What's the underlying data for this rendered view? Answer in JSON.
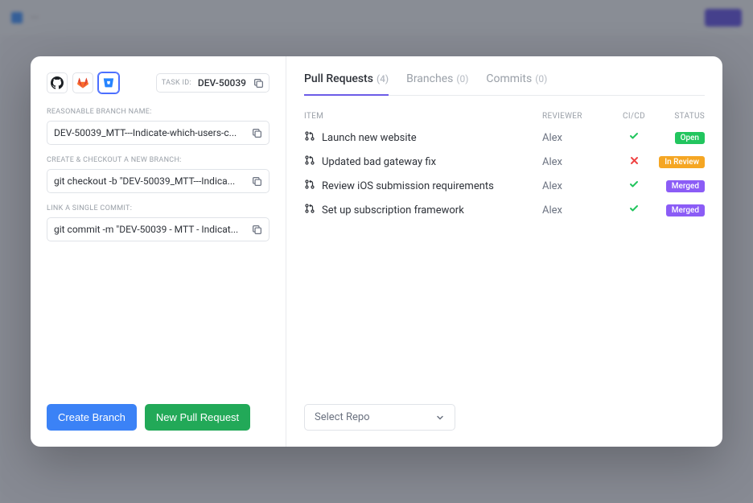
{
  "task_id": {
    "label": "TASK ID:",
    "value": "DEV-50039"
  },
  "fields": {
    "branch_name": {
      "label": "REASONABLE BRANCH NAME:",
      "value": "DEV-50039_MTT---Indicate-which-users-c..."
    },
    "checkout": {
      "label": "CREATE & CHECKOUT A NEW BRANCH:",
      "value": "git checkout -b \"DEV-50039_MTT---Indica..."
    },
    "commit": {
      "label": "LINK A SINGLE COMMIT:",
      "value": "git commit -m \"DEV-50039 - MTT - Indicat..."
    }
  },
  "buttons": {
    "create_branch": "Create Branch",
    "new_pr": "New Pull Request"
  },
  "tabs": [
    {
      "label": "Pull Requests",
      "count": "(4)",
      "active": true
    },
    {
      "label": "Branches",
      "count": "(0)",
      "active": false
    },
    {
      "label": "Commits",
      "count": "(0)",
      "active": false
    }
  ],
  "columns": {
    "item": "ITEM",
    "reviewer": "REVIEWER",
    "cicd": "CI/CD",
    "status": "STATUS"
  },
  "rows": [
    {
      "title": "Launch new website",
      "reviewer": "Alex",
      "cicd": "check",
      "status": "Open",
      "status_class": "status-open"
    },
    {
      "title": "Updated bad gateway fix",
      "reviewer": "Alex",
      "cicd": "cross",
      "status": "In Review",
      "status_class": "status-inreview"
    },
    {
      "title": "Review iOS submission requirements",
      "reviewer": "Alex",
      "cicd": "check",
      "status": "Merged",
      "status_class": "status-merged"
    },
    {
      "title": "Set up subscription framework",
      "reviewer": "Alex",
      "cicd": "check",
      "status": "Merged",
      "status_class": "status-merged"
    }
  ],
  "select_repo": "Select Repo"
}
